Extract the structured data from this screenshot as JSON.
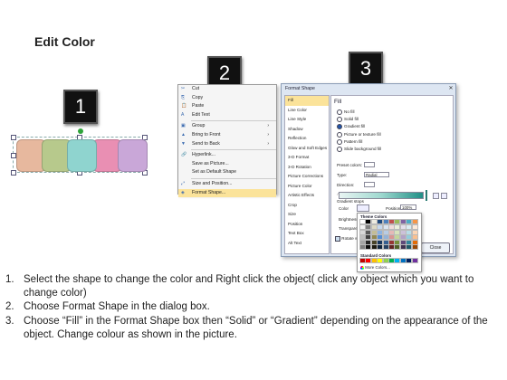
{
  "title": "Edit Color",
  "badges": [
    "1",
    "2",
    "3"
  ],
  "panel1": {
    "shape_colors": [
      "#e7b89e",
      "#b7c98c",
      "#8fd4cf",
      "#e98fb3",
      "#c9a7d8"
    ]
  },
  "context_menu": {
    "items": [
      {
        "icon": "✂",
        "icon_name": "cut-icon",
        "label": "Cut"
      },
      {
        "icon": "⎘",
        "icon_name": "copy-icon",
        "label": "Copy"
      },
      {
        "icon": "📋",
        "icon_name": "paste-icon",
        "label": "Paste"
      },
      {
        "icon": "A",
        "icon_name": "edit-text-icon",
        "label": "Edit Text"
      },
      {
        "icon": "▣",
        "icon_name": "group-icon",
        "label": "Group",
        "arrow": "›"
      },
      {
        "icon": "▲",
        "icon_name": "bring-to-front-icon",
        "label": "Bring to Front",
        "arrow": "›"
      },
      {
        "icon": "▼",
        "icon_name": "send-to-back-icon",
        "label": "Send to Back",
        "arrow": "›"
      },
      {
        "icon": "🔗",
        "icon_name": "hyperlink-icon",
        "label": "Hyperlink..."
      },
      {
        "icon": "",
        "icon_name": "",
        "label": "Save as Picture..."
      },
      {
        "icon": "",
        "icon_name": "",
        "label": "Set as Default Shape"
      },
      {
        "icon": "⤢",
        "icon_name": "size-position-icon",
        "label": "Size and Position..."
      },
      {
        "icon": "◈",
        "icon_name": "format-shape-icon",
        "label": "Format Shape...",
        "highlight": true
      }
    ]
  },
  "format_dialog": {
    "title": "Format Shape",
    "close_glyph": "✕",
    "nav": [
      "Fill",
      "Line Color",
      "Line Style",
      "Shadow",
      "Reflection",
      "Glow and Soft Edges",
      "3-D Format",
      "3-D Rotation",
      "Picture Corrections",
      "Picture Color",
      "Artistic Effects",
      "Crop",
      "Size",
      "Position",
      "Text Box",
      "Alt Text"
    ],
    "pane_title": "Fill",
    "fill_options": [
      {
        "label": "No fill",
        "selected": false
      },
      {
        "label": "Solid fill",
        "selected": false
      },
      {
        "label": "Gradient fill",
        "selected": true
      },
      {
        "label": "Picture or texture fill",
        "selected": false
      },
      {
        "label": "Pattern fill",
        "selected": false
      },
      {
        "label": "Slide background fill",
        "selected": false
      }
    ],
    "preset_label": "Preset colors:",
    "type_label": "Type:",
    "type_value": "Radial",
    "direction_label": "Direction:",
    "angle_label": "Angle:",
    "gradient_stops_label": "Gradient stops",
    "color_label": "Color",
    "position_label": "Position:",
    "position_value": "100%",
    "brightness_label": "Brightness",
    "transparency_label": "Transpare",
    "rotate_label": "Rotate w",
    "close_button": "Close"
  },
  "palette": {
    "theme_label": "Theme Colors",
    "theme_top": [
      "#ffffff",
      "#000000",
      "#eeece1",
      "#1f497d",
      "#4f81bd",
      "#c0504d",
      "#9bbb59",
      "#8064a2",
      "#4bacc6",
      "#f79646"
    ],
    "theme_rows": [
      [
        "#f2f2f2",
        "#7f7f7f",
        "#ddd9c3",
        "#c6d9f0",
        "#dbe5f1",
        "#f2dcdb",
        "#ebf1dd",
        "#e5e0ec",
        "#dbeef3",
        "#fdeada"
      ],
      [
        "#d8d8d8",
        "#595959",
        "#c4bd97",
        "#8db3e2",
        "#b8cce4",
        "#e5b9b7",
        "#d7e3bc",
        "#ccc1d9",
        "#b7dde8",
        "#fbd5b5"
      ],
      [
        "#bfbfbf",
        "#3f3f3f",
        "#938953",
        "#548dd4",
        "#95b3d7",
        "#d99694",
        "#c3d69b",
        "#b2a2c7",
        "#92cddc",
        "#fac08f"
      ],
      [
        "#a5a5a5",
        "#262626",
        "#494429",
        "#17365d",
        "#366092",
        "#953734",
        "#76923c",
        "#5f497a",
        "#31859b",
        "#e36c09"
      ],
      [
        "#7f7f7f",
        "#0c0c0c",
        "#1d1b10",
        "#0f243e",
        "#244061",
        "#632423",
        "#4f6128",
        "#3f3151",
        "#205867",
        "#974806"
      ]
    ],
    "standard_label": "Standard Colors",
    "standard": [
      "#c00000",
      "#ff0000",
      "#ffc000",
      "#ffff00",
      "#92d050",
      "#00b050",
      "#00b0f0",
      "#0070c0",
      "#002060",
      "#7030a0"
    ],
    "more_label": "More Colors..."
  },
  "steps": [
    {
      "num": "1.",
      "text": "Select the shape to change the color and Right click the object( click any object which you want to change color)"
    },
    {
      "num": "2.",
      "text": "Choose Format Shape in the dialog box."
    },
    {
      "num": "3.",
      "text": "Choose “Fill” in the Format Shape box then “Solid” or “Gradient” depending on the appearance of the object. Change colour as shown in the picture."
    }
  ]
}
